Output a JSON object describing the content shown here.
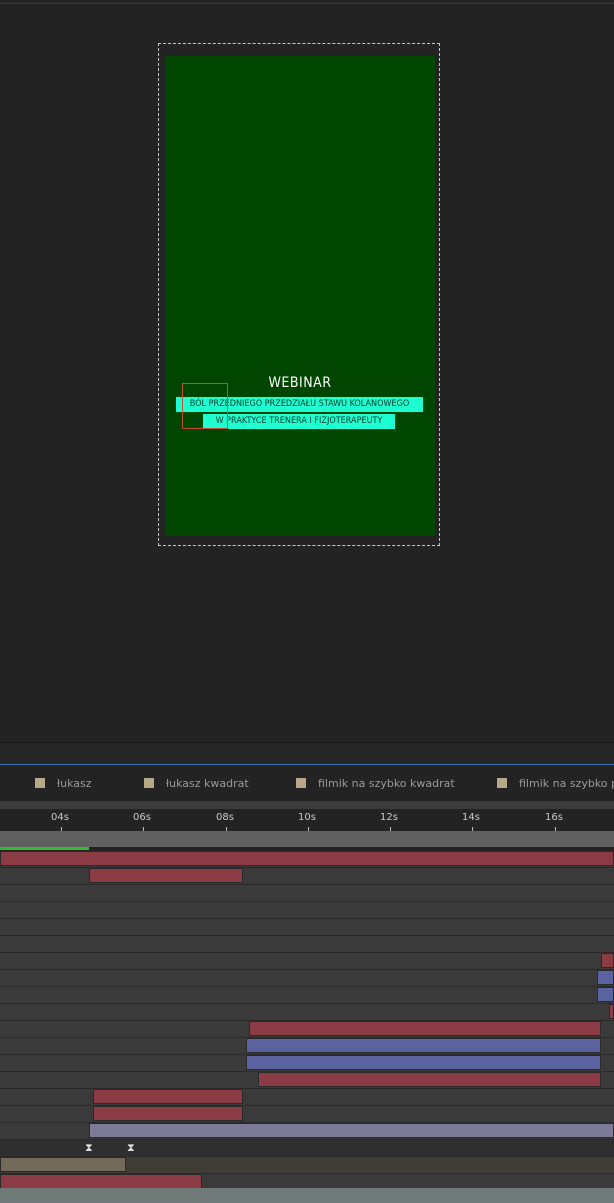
{
  "viewer": {
    "title": "WEBINAR",
    "subtitle_line1": "BÓL PRZEDNIEGO PRZEDZIAŁU STAWU KOLANOWEGO",
    "subtitle_line2": "W PRAKTYCE TRENERA I FIZJOTERAPEUTY",
    "background_color": "#004500",
    "highlight_color": "#1effd1"
  },
  "tabs": [
    {
      "label": "łukasz",
      "icon": "composition-swatch-icon"
    },
    {
      "label": "łukasz kwadrat",
      "icon": "composition-swatch-icon"
    },
    {
      "label": "filmik na szybko kwadrat",
      "icon": "composition-swatch-icon"
    },
    {
      "label": "filmik na szybko pio",
      "icon": "composition-swatch-icon"
    }
  ],
  "ruler": {
    "ticks": [
      "04s",
      "06s",
      "08s",
      "10s",
      "12s",
      "14s",
      "16s"
    ]
  },
  "colors": {
    "layer_red": "#8a3b43",
    "layer_blue": "#5a63a0",
    "layer_lavender": "#7d7a98",
    "progress": "#39b539",
    "active_tab_line": "#3b6fb0"
  },
  "timeline": {
    "markers": [
      "work-area-start-marker",
      "work-area-end-marker"
    ]
  }
}
